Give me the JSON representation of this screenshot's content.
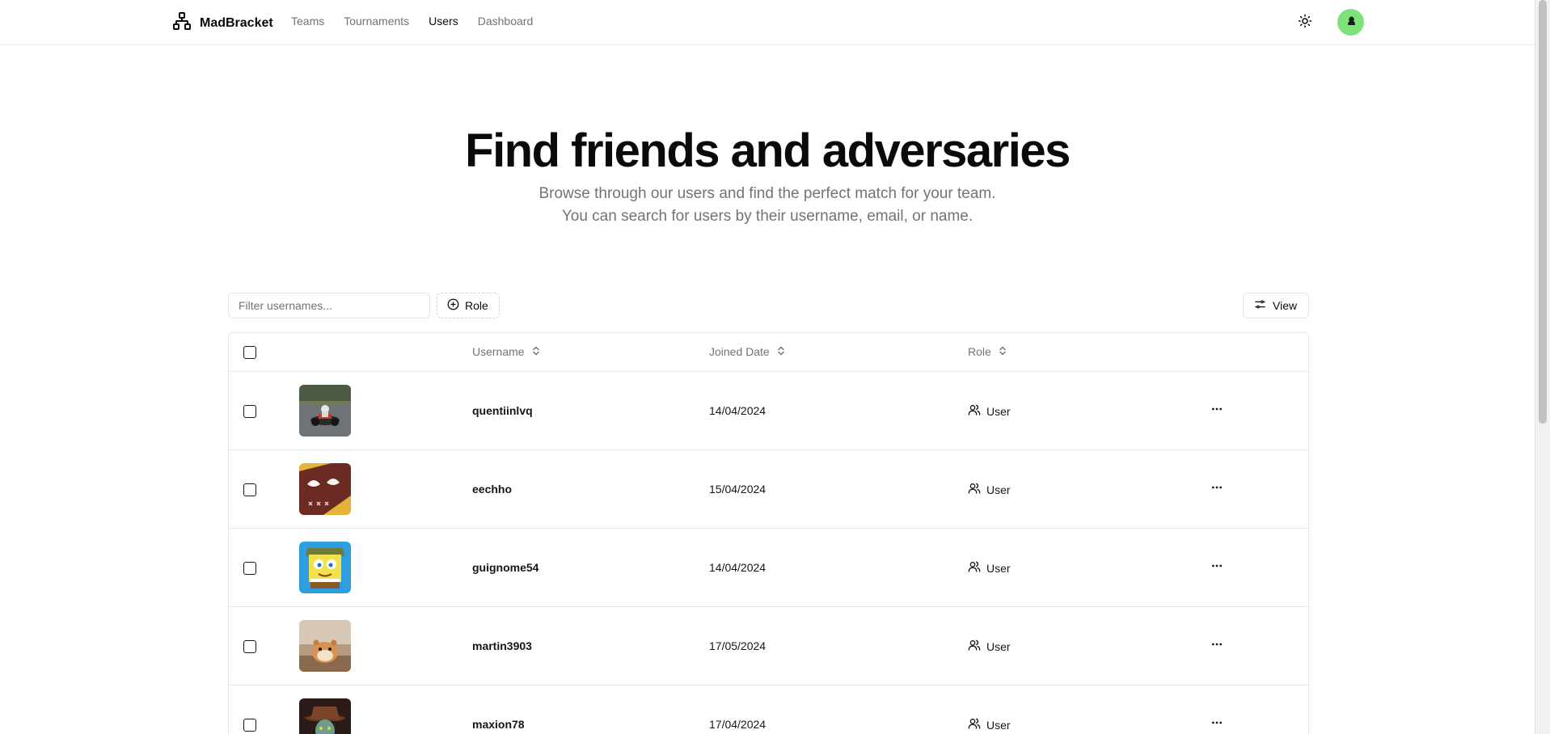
{
  "app": {
    "name": "MadBracket"
  },
  "nav": {
    "items": [
      {
        "label": "Teams",
        "active": false
      },
      {
        "label": "Tournaments",
        "active": false
      },
      {
        "label": "Users",
        "active": true
      },
      {
        "label": "Dashboard",
        "active": false
      }
    ]
  },
  "header_icons": {
    "theme": "sun-icon",
    "avatar_color": "#7ee27a"
  },
  "hero": {
    "title": "Find friends and adversaries",
    "subtitle": "Browse through our users and find the perfect match for your team. You can search for users by their username, email, or name."
  },
  "toolbar": {
    "filter_placeholder": "Filter usernames...",
    "role_label": "Role",
    "view_label": "View"
  },
  "table": {
    "columns": {
      "username": "Username",
      "joined": "Joined Date",
      "role": "Role"
    },
    "rows": [
      {
        "username": "quentiinlvq",
        "joined": "14/04/2024",
        "role": "User",
        "avatar": "go-kart photo"
      },
      {
        "username": "eechho",
        "joined": "15/04/2024",
        "role": "User",
        "avatar": "cartoon creature"
      },
      {
        "username": "guignome54",
        "joined": "14/04/2024",
        "role": "User",
        "avatar": "sponge cartoon"
      },
      {
        "username": "martin3903",
        "joined": "17/05/2024",
        "role": "User",
        "avatar": "hamster photo"
      },
      {
        "username": "maxion78",
        "joined": "17/04/2024",
        "role": "User",
        "avatar": "cowboy character"
      }
    ]
  },
  "colors": {
    "border": "#e5e5e5",
    "muted_text": "#737373",
    "text": "#0a0a0a"
  }
}
